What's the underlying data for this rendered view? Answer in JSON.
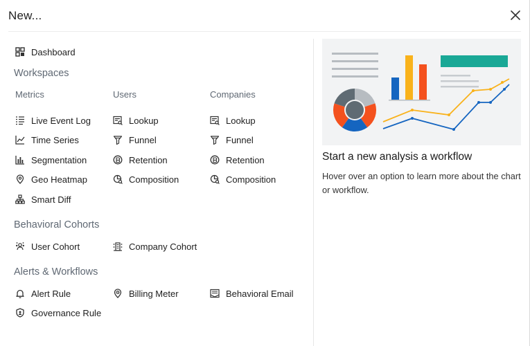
{
  "dialog": {
    "title": "New...",
    "close_icon": "close-icon"
  },
  "menu": {
    "dashboard": {
      "label": "Dashboard",
      "icon": "dashboard-grid-icon"
    },
    "workspaces_heading": "Workspaces",
    "columns": {
      "metrics": "Metrics",
      "users": "Users",
      "companies": "Companies"
    },
    "metrics": [
      {
        "label": "Live Event Log",
        "icon": "live-event-log-icon"
      },
      {
        "label": "Time Series",
        "icon": "time-series-icon"
      },
      {
        "label": "Segmentation",
        "icon": "segmentation-icon"
      },
      {
        "label": "Geo Heatmap",
        "icon": "geo-pin-icon"
      },
      {
        "label": "Smart Diff",
        "icon": "hierarchy-icon"
      }
    ],
    "users": [
      {
        "label": "Lookup",
        "icon": "lookup-icon"
      },
      {
        "label": "Funnel",
        "icon": "funnel-icon"
      },
      {
        "label": "Retention",
        "icon": "retention-icon"
      },
      {
        "label": "Composition",
        "icon": "composition-icon"
      }
    ],
    "companies": [
      {
        "label": "Lookup",
        "icon": "lookup-icon"
      },
      {
        "label": "Funnel",
        "icon": "funnel-icon"
      },
      {
        "label": "Retention",
        "icon": "retention-icon"
      },
      {
        "label": "Composition",
        "icon": "composition-icon"
      }
    ],
    "cohorts_heading": "Behavioral Cohorts",
    "cohorts": [
      {
        "label": "User Cohort",
        "icon": "user-cohort-icon"
      },
      {
        "label": "Company Cohort",
        "icon": "company-cohort-icon"
      }
    ],
    "alerts_heading": "Alerts & Workflows",
    "alerts": [
      {
        "label": "Alert Rule",
        "icon": "bell-icon"
      },
      {
        "label": "Billing Meter",
        "icon": "billing-meter-icon"
      },
      {
        "label": "Behavioral Email",
        "icon": "email-icon"
      },
      {
        "label": "Governance Rule",
        "icon": "shield-icon"
      }
    ]
  },
  "panel": {
    "title": "Start a new analysis a workflow",
    "description": "Hover over an option to learn more about the chart or workflow.",
    "colors": {
      "teal": "#1aa896",
      "blue": "#1565c0",
      "amber": "#f9b21b",
      "orange": "#f4511e",
      "slate": "#5f6b73",
      "gray": "#b7bcc1"
    }
  }
}
